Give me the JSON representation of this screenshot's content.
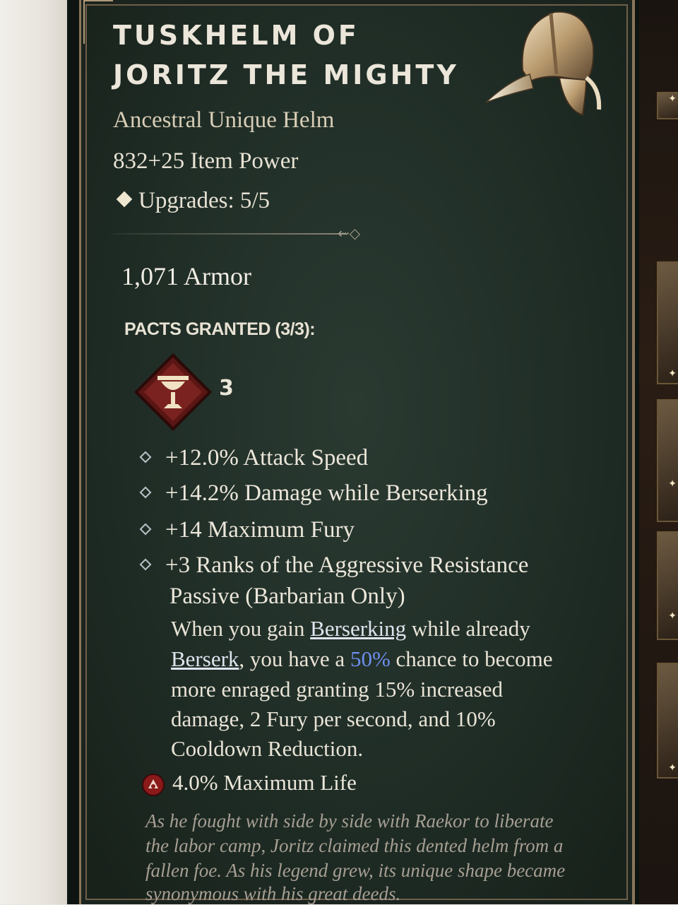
{
  "item": {
    "name_line1": "TUSKHELM OF",
    "name_line2": "JORITZ THE MIGHTY",
    "type": "Ancestral Unique Helm",
    "item_power": "832+25 Item Power",
    "upgrades": "Upgrades: 5/5",
    "armor": "1,071 Armor",
    "pacts_label": "PACTS GRANTED (3/3):",
    "pact_count": "3",
    "affixes": [
      "+12.0% Attack Speed",
      "+14.2% Damage while Berserking",
      "+14 Maximum Fury",
      "+3 Ranks of the Aggressive Resistance"
    ],
    "affix_continuation": "Passive (Barbarian Only)",
    "unique_effect": {
      "line1_a": "When you gain ",
      "line1_kw": "Berserking",
      "line1_b": " while already",
      "line2_kw": "Berserk",
      "line2_a": ", you have a ",
      "line2_num": "50%",
      "line2_b": " chance to become",
      "line3": "more enraged granting 15% increased",
      "line4": "damage, 2 Fury per second, and 10%",
      "line5": "Cooldown Reduction."
    },
    "socket_stat": "4.0% Maximum Life",
    "flavor": [
      "As he fought with side by side with Raekor to liberate",
      "the labor camp, Joritz claimed this dented helm from a",
      "fallen foe. As his legend grew, its unique shape became",
      "synonymous with his great deeds."
    ]
  },
  "colors": {
    "panel_bg": "#1f2d26",
    "border": "#8a765a",
    "keyword": "#dfe4ee",
    "highlight_number": "#6e8ff0",
    "flavor_text": "#a79f93"
  },
  "icons": {
    "item": "horned-helm-icon",
    "pact": "chalice-pact-icon",
    "socket": "life-gem-icon",
    "upgrades": "diamond-icon",
    "affix_bullet": "diamond-bullet-icon"
  }
}
